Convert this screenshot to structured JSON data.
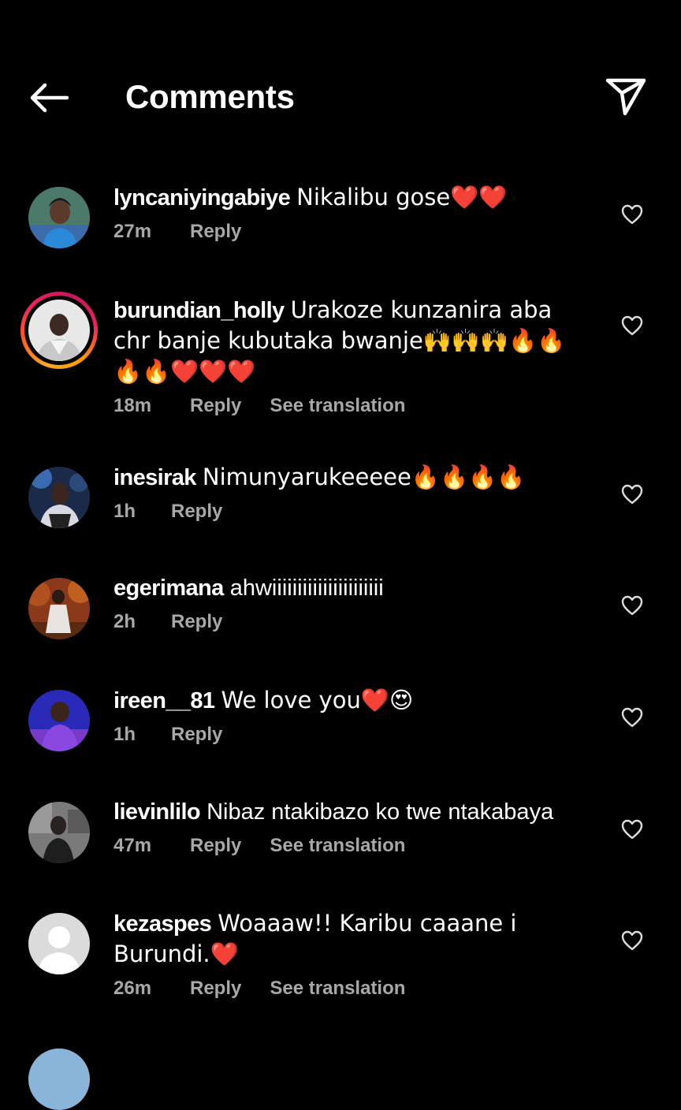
{
  "header": {
    "title": "Comments",
    "back_icon": "arrow-left-icon",
    "share_icon": "paper-plane-icon"
  },
  "colors": {
    "background": "#000000",
    "text": "#ffffff",
    "meta": "#a8a8a8"
  },
  "comments": [
    {
      "username": "lyncaniyingabiye",
      "text": "Nikalibu gose❤️❤️",
      "time": "27m",
      "reply": "Reply",
      "translation": ""
    },
    {
      "username": "burundian_holly",
      "text": "Urakoze kunzanira aba chr banje kubutaka bwanje🙌🙌🙌🔥🔥🔥🔥❤️❤️❤️",
      "time": "18m",
      "reply": "Reply",
      "translation": "See translation"
    },
    {
      "username": "inesirak",
      "text": "Nimunyarukeeeee🔥🔥🔥🔥",
      "time": "1h",
      "reply": "Reply",
      "translation": ""
    },
    {
      "username": "egerimana",
      "text": "ahwiiiiiiiiiiiiiiiiiiiiii",
      "time": "2h",
      "reply": "Reply",
      "translation": ""
    },
    {
      "username": "ireen__81",
      "text": "We love you❤️😍",
      "time": "1h",
      "reply": "Reply",
      "translation": ""
    },
    {
      "username": "lievinlilo",
      "text": "Nibaz ntakibazo ko twe ntakabaya",
      "time": "47m",
      "reply": "Reply",
      "translation": "See translation"
    },
    {
      "username": "kezaspes",
      "text": "Woaaaw!! Karibu caaane i Burundi.❤️",
      "time": "26m",
      "reply": "Reply",
      "translation": "See translation"
    }
  ]
}
